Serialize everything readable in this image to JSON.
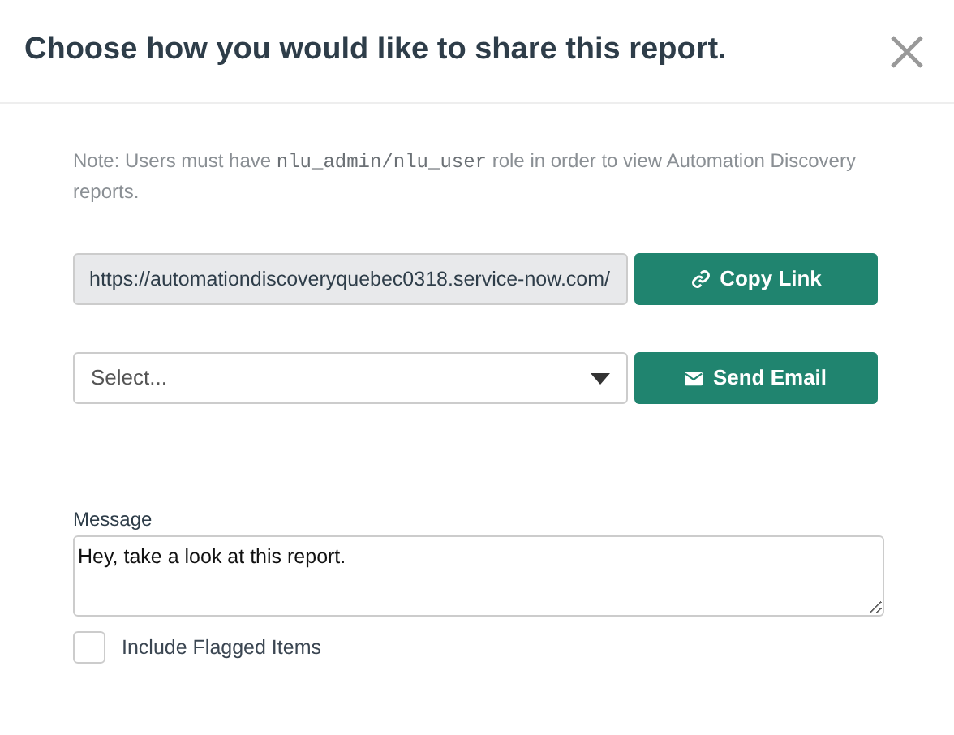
{
  "dialog": {
    "title": "Choose how you would like to share this report."
  },
  "note": [
    {
      "kind": "text",
      "text": "Note: Users must have "
    },
    {
      "kind": "code",
      "text": "nlu_admin/nlu_user"
    },
    {
      "kind": "text",
      "text": " role in order to view Automation Discovery reports."
    }
  ],
  "link": {
    "value": "https://automationdiscoveryquebec0318.service-now.com/",
    "button": "Copy Link"
  },
  "email": {
    "placeholder": "Select...",
    "button": "Send Email"
  },
  "message": {
    "label": "Message",
    "value": "Hey, take a look at this report."
  },
  "include_flagged": {
    "label": "Include Flagged Items",
    "checked": false
  }
}
